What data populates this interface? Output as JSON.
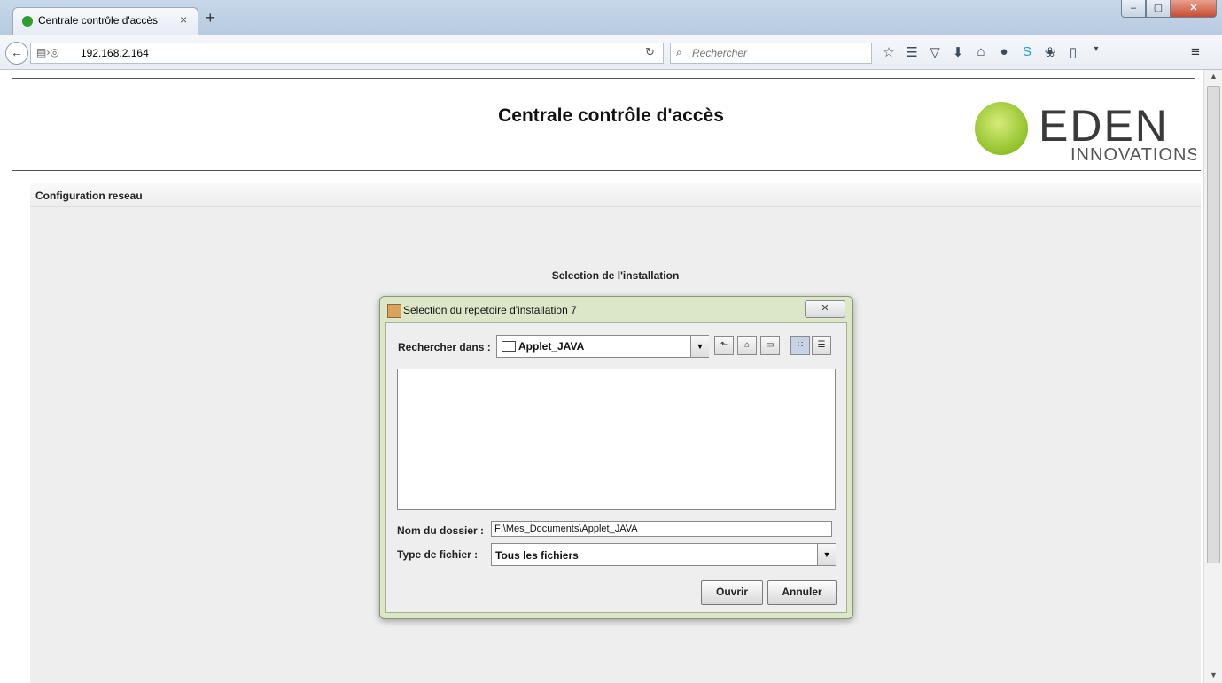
{
  "browser": {
    "tab_title": "Centrale contrôle d'accès",
    "tab_close": "×",
    "new_tab": "+",
    "url": "192.168.2.164",
    "search_placeholder": "Rechercher",
    "window_buttons": {
      "minimize": "‒",
      "maximize": "▢",
      "close": "✕"
    },
    "toolbar_icons": [
      "star-icon",
      "reading-list-icon",
      "pocket-icon",
      "download-icon",
      "home-icon",
      "chat-icon",
      "skype-icon",
      "extension-icon",
      "clipboard-icon",
      "dropdown-icon"
    ]
  },
  "page": {
    "title": "Centrale contrôle d'accès",
    "logo": {
      "brand": "EDEN",
      "tagline": "INNOVATIONS",
      "colors": {
        "ball": "#a6cf3a",
        "text": "#3a3a3a"
      }
    },
    "section": "Configuration reseau",
    "applet_title": "Selection de l'installation"
  },
  "dialog": {
    "title": "Selection du repetoire d'installation 7",
    "close": "✕",
    "look_in_label": "Rechercher dans :",
    "look_in_value": "Applet_JAVA",
    "folder_name_label": "Nom du dossier :",
    "folder_name_value": "F:\\Mes_Documents\\Applet_JAVA",
    "file_type_label": "Type de fichier :",
    "file_type_value": "Tous les fichiers",
    "open_button": "Ouvrir",
    "cancel_button": "Annuler"
  }
}
